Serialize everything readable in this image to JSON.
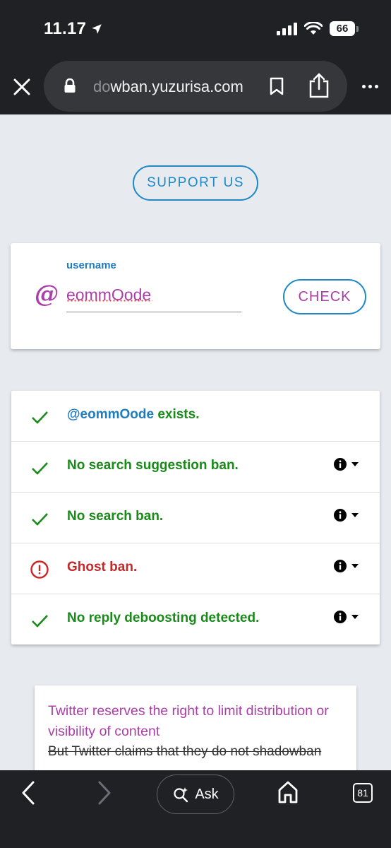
{
  "status_bar": {
    "time": "11.17",
    "battery": "66"
  },
  "browser": {
    "url_faded": "do",
    "url_main": "wban.yuzurisa.com"
  },
  "page": {
    "support_label": "SUPPORT US",
    "search": {
      "at_symbol": "@",
      "field_label": "username",
      "username_value": "eommOode",
      "check_label": "CHECK"
    },
    "results": [
      {
        "status": "ok",
        "handle": "@eommOode",
        "text": " exists.",
        "has_info": false
      },
      {
        "status": "ok",
        "text": "No search suggestion ban.",
        "has_info": true
      },
      {
        "status": "ok",
        "text": "No search ban.",
        "has_info": true
      },
      {
        "status": "bad",
        "text": "Ghost ban.",
        "has_info": true
      },
      {
        "status": "ok",
        "text": "No reply deboosting detected.",
        "has_info": true
      }
    ],
    "note": {
      "main": "Twitter reserves the right to limit distribution or visibility of content",
      "strike": "But Twitter claims that they do not shadowban"
    }
  },
  "toolbar": {
    "ask_label": "Ask",
    "tab_count": "81"
  },
  "colors": {
    "accent_blue": "#1e88c8",
    "accent_purple": "#ab3ea8",
    "ok_green": "#1a8a1a",
    "error_red": "#c62828"
  }
}
